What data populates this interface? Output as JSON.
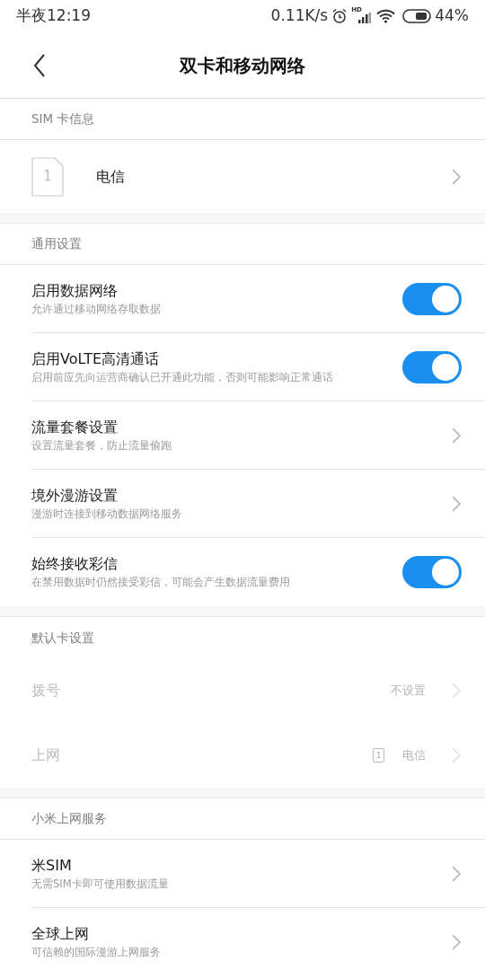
{
  "status_bar": {
    "time": "半夜12:19",
    "speed": "0.11K/s",
    "signal_label": "HD",
    "battery": "44%"
  },
  "header": {
    "title": "双卡和移动网络"
  },
  "sections": [
    {
      "title": "SIM 卡信息",
      "dividers": true,
      "rows": [
        {
          "kind": "sim",
          "slot": "1",
          "title": "电信"
        }
      ]
    },
    {
      "title": "通用设置",
      "dividers": true,
      "rows": [
        {
          "kind": "toggle",
          "title": "启用数据网络",
          "subtitle": "允许通过移动网络存取数据",
          "on": true
        },
        {
          "kind": "toggle",
          "title": "启用VoLTE高清通话",
          "subtitle": "启用前应先向运营商确认已开通此功能，否则可能影响正常通话",
          "on": true
        },
        {
          "kind": "link",
          "title": "流量套餐设置",
          "subtitle": "设置流量套餐，防止流量偷跑"
        },
        {
          "kind": "link",
          "title": "境外漫游设置",
          "subtitle": "漫游时连接到移动数据网络服务"
        },
        {
          "kind": "toggle",
          "title": "始终接收彩信",
          "subtitle": "在禁用数据时仍然接受彩信，可能会产生数据流量费用",
          "on": true
        }
      ]
    },
    {
      "title": "默认卡设置",
      "dividers": false,
      "rows": [
        {
          "kind": "value",
          "title": "拨号",
          "value": "不设置",
          "disabled": true
        },
        {
          "kind": "value",
          "title": "上网",
          "value": "电信",
          "slot": "1",
          "disabled": true
        }
      ]
    },
    {
      "title": "小米上网服务",
      "dividers": true,
      "rows": [
        {
          "kind": "link",
          "title": "米SIM",
          "subtitle": "无需SIM卡即可使用数据流量"
        },
        {
          "kind": "link",
          "title": "全球上网",
          "subtitle": "可信赖的国际漫游上网服务"
        }
      ]
    }
  ]
}
